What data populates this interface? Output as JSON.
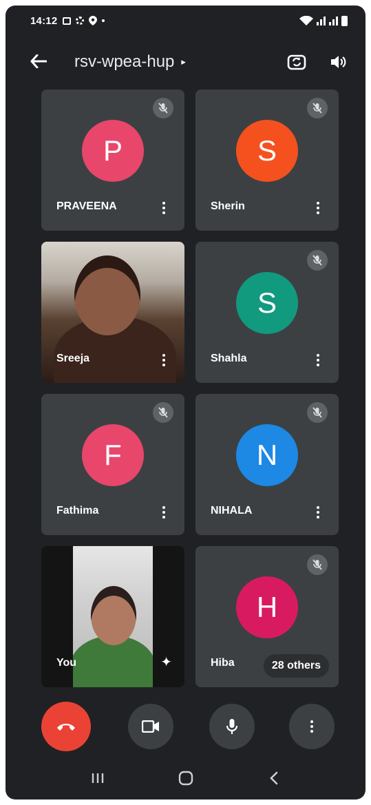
{
  "status_bar": {
    "time": "14:12",
    "left_icons": [
      "gallery-icon",
      "settings-icon",
      "location-icon",
      "dot-icon"
    ],
    "right_icons": [
      "wifi-icon",
      "signal-icon",
      "signal-icon",
      "battery-icon"
    ]
  },
  "app_bar": {
    "meeting_code": "rsv-wpea-hup",
    "caret": "▸",
    "back_icon": "back-arrow-icon",
    "switch_camera_icon": "switch-camera-icon",
    "speaker_icon": "speaker-icon"
  },
  "participants": [
    {
      "name": "PRAVEENA",
      "initial": "P",
      "color": "#e8466b",
      "muted": true,
      "video": false
    },
    {
      "name": "Sherin",
      "initial": "S",
      "color": "#f4511e",
      "muted": true,
      "video": false
    },
    {
      "name": "Sreeja",
      "initial": "",
      "color": "",
      "muted": false,
      "video": true
    },
    {
      "name": "Shahla",
      "initial": "S",
      "color": "#129a7e",
      "muted": true,
      "video": false
    },
    {
      "name": "Fathima",
      "initial": "F",
      "color": "#e8466b",
      "muted": true,
      "video": false
    },
    {
      "name": "NIHALA",
      "initial": "N",
      "color": "#1e88e5",
      "muted": true,
      "video": false
    },
    {
      "name": "You",
      "initial": "",
      "color": "",
      "muted": false,
      "video": true
    },
    {
      "name": "Hiba",
      "initial": "H",
      "color": "#d81b60",
      "muted": true,
      "video": false
    }
  ],
  "others_chip": "28 others",
  "controls": {
    "end_call_icon": "end-call-icon",
    "camera_icon": "camera-icon",
    "mic_icon": "microphone-icon",
    "more_icon": "more-options-icon"
  },
  "nav_bar": [
    "recent-apps-icon",
    "home-icon",
    "back-icon"
  ],
  "colors": {
    "background": "#202124",
    "tile": "#3c4043",
    "end_call": "#ea4335"
  }
}
